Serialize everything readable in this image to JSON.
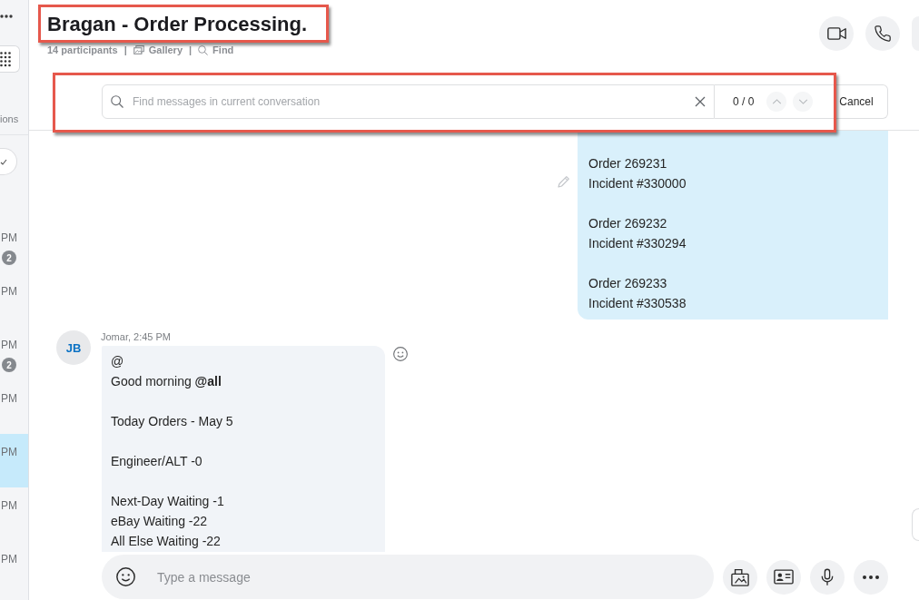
{
  "sidebar": {
    "section_label": "ions",
    "items": [
      {
        "time": "PM",
        "badge": "2",
        "selected": false
      },
      {
        "time": "PM",
        "selected": false
      },
      {
        "time": "PM",
        "badge": "2",
        "selected": false
      },
      {
        "time": "PM",
        "selected": false
      },
      {
        "time": "PM",
        "selected": true
      },
      {
        "time": "PM",
        "selected": false
      },
      {
        "time": "PM",
        "selected": false
      }
    ]
  },
  "conversation": {
    "title": "Bragan - Order Processing.",
    "participants": "14 participants",
    "separator": "|",
    "links": [
      {
        "kind": "gallery",
        "label": "Gallery"
      },
      {
        "kind": "find",
        "label": "Find"
      }
    ]
  },
  "find_bar": {
    "placeholder": "Find messages in current conversation",
    "counter": "0 / 0",
    "cancel": "Cancel"
  },
  "messages": [
    {
      "kind": "outgoing",
      "edited": true,
      "paragraphs": [
        [
          "Order 269231",
          "Incident #330000"
        ],
        [
          "Order 269232",
          "Incident #330294"
        ],
        [
          "Order 269233",
          "Incident #330538"
        ]
      ]
    },
    {
      "kind": "incoming",
      "avatar_initials": "JB",
      "sender": "Jomar, 2:45 PM",
      "paragraphs": [
        [
          "@",
          "Good morning **@all**"
        ],
        [
          "Today Orders - May 5"
        ],
        [
          "Engineer/ALT -0"
        ],
        [
          "Next-Day Waiting -1",
          "eBay Waiting -22",
          "All Else Waiting -22"
        ]
      ]
    }
  ],
  "composer": {
    "placeholder": "Type a message"
  }
}
